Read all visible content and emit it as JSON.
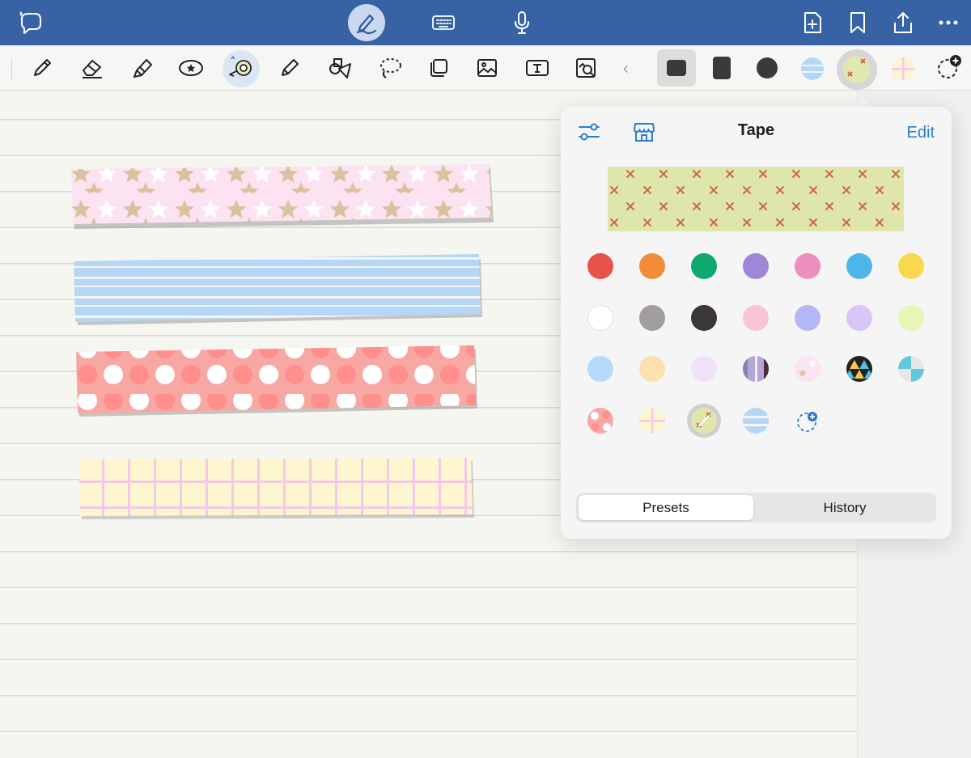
{
  "popover": {
    "title": "Tape",
    "edit_label": "Edit",
    "segments": {
      "presets": "Presets",
      "history": "History",
      "selected": "Presets"
    }
  },
  "colors": {
    "topbar": "#3763a5",
    "accent": "#2a7cd2",
    "solid_swatches": [
      "#e9524a",
      "#f28c38",
      "#10a86c",
      "#9f86d7",
      "#ec8fbe",
      "#4db6e9",
      "#f9d84e",
      "#ffffff",
      "#a29e9e",
      "#3b3637",
      "#f9c4d6",
      "#b4b8f6",
      "#d8c6f6",
      "#e6f6b4",
      "#b5d9fb",
      "#fce0ae",
      "#f0e2f8"
    ]
  },
  "icons": {
    "topbar": [
      "lasso-comment-icon",
      "handwriting-pen-icon",
      "keyboard-icon",
      "microphone-icon",
      "add-page-icon",
      "bookmark-icon",
      "share-icon",
      "more-icon"
    ],
    "tools": [
      "pen-icon",
      "eraser-icon",
      "highlighter-icon",
      "sticker-icon",
      "tape-icon",
      "pencil-icon",
      "shapes-icon",
      "lasso-icon",
      "element-icon",
      "image-icon",
      "text-box-icon",
      "zoom-window-icon",
      "collapse-chevron-icon"
    ],
    "tape_shapes": [
      "rounded-rect-wide",
      "rounded-rect-tall",
      "circle"
    ],
    "popover": [
      "settings-sliders-icon",
      "store-icon",
      "add-custom-tape-icon"
    ]
  }
}
